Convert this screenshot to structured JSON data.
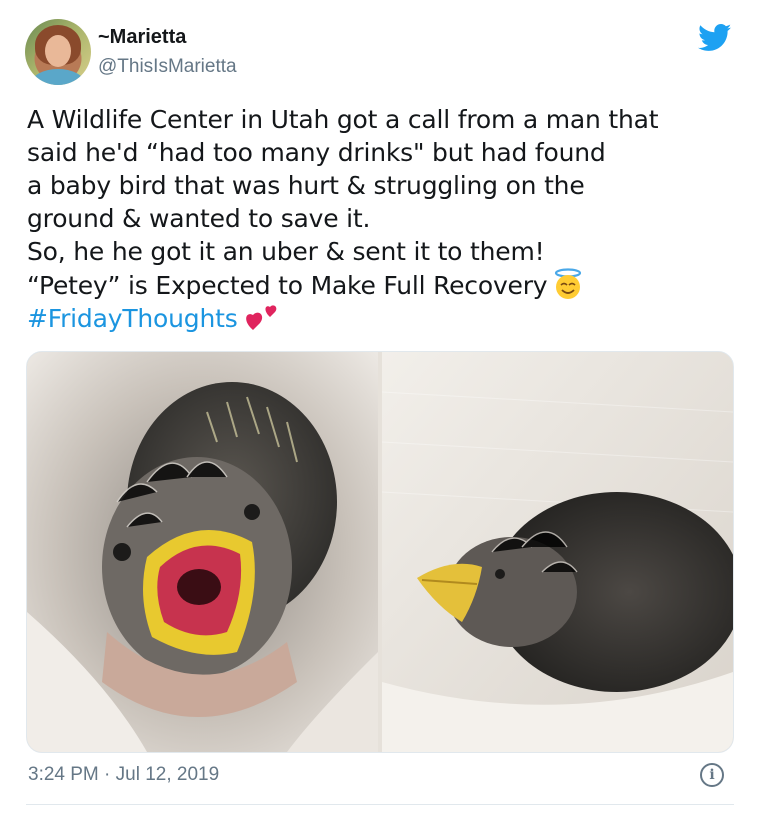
{
  "user": {
    "display_name": "~Marietta",
    "handle": "@ThisIsMarietta",
    "avatar_icon": "profile-photo"
  },
  "brand": {
    "icon": "twitter-bird-icon",
    "color": "#1da1f2"
  },
  "tweet": {
    "lines": [
      "A Wildlife Center in Utah got a call from a man that",
      "said he'd “had too many drinks\" but had found",
      "a baby bird that was hurt & struggling on the",
      "ground & wanted to save it.",
      "So, he he got it an uber & sent it to them!",
      "“Petey” is Expected to Make Full Recovery"
    ],
    "hashtag": "#FridayThoughts",
    "emojis": [
      "smiling-face-with-halo",
      "two-hearts"
    ],
    "hashtag_color": "#1b95e0"
  },
  "media": [
    {
      "name": "baby-bird-photo-open-beak"
    },
    {
      "name": "baby-bird-photo-side"
    }
  ],
  "footer": {
    "timestamp": "3:24 PM · Jul 12, 2019",
    "info_label": "i"
  }
}
